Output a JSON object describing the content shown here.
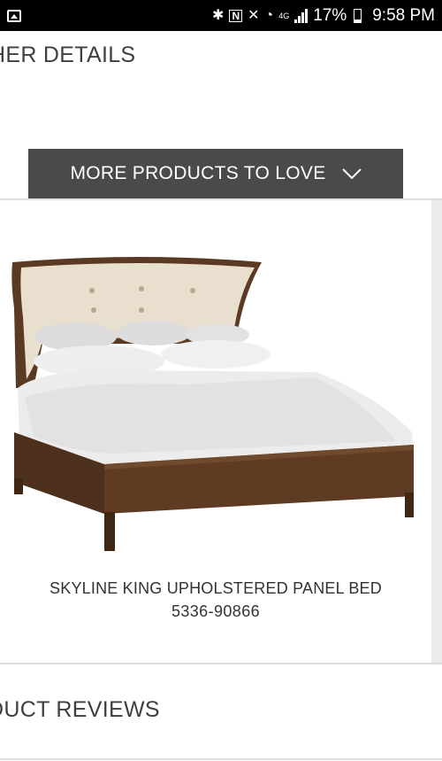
{
  "status_bar": {
    "battery_percent": "17%",
    "battery_level": 0.17,
    "time": "9:58 PM",
    "network_label": "4G",
    "icons": [
      "gallery-icon",
      "bluetooth-icon",
      "nfc-icon",
      "mute-icon",
      "wifi-icon",
      "signal-icon",
      "battery-icon"
    ]
  },
  "sections": {
    "other_details_title": "HER DETAILS",
    "reviews_title": "DUCT REVIEWS"
  },
  "more_products": {
    "label": "MORE PRODUCTS TO LOVE",
    "icon": "chevron-down-icon"
  },
  "product": {
    "name": "SKYLINE KING UPHOLSTERED PANEL BED",
    "sku": "5336-90866",
    "colors": {
      "wood": "#5a3a22",
      "headboard": "#e8dfcf",
      "bedding": "#ececec"
    }
  }
}
